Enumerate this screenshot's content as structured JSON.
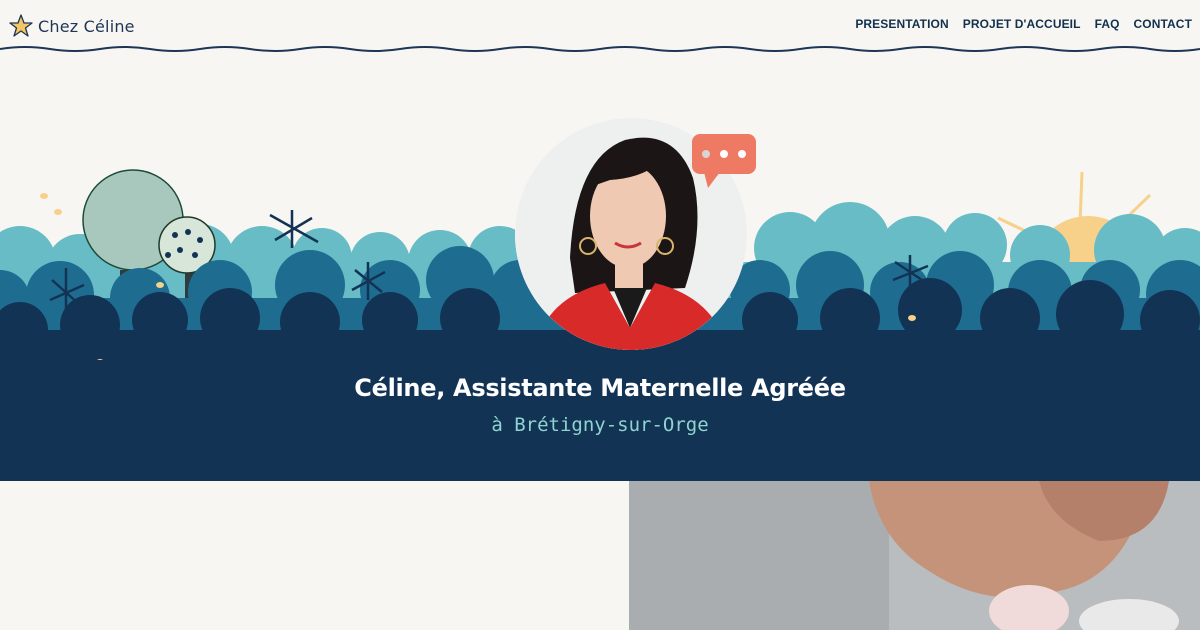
{
  "header": {
    "logo_text": "Chez Céline",
    "logo_icon": "star-icon",
    "nav": [
      {
        "label": "PRESENTATION"
      },
      {
        "label": "PROJET D'ACCUEIL"
      },
      {
        "label": "FAQ"
      },
      {
        "label": "CONTACT"
      }
    ]
  },
  "hero": {
    "title": "Céline, Assistante Maternelle Agréée",
    "subtitle": "à Brétigny-sur-Orge",
    "portrait_icon": "portrait-photo",
    "chat_icon": "chat-bubble-icon"
  },
  "colors": {
    "background": "#f7f6f2",
    "navy": "#123354",
    "teal": "#67bcc6",
    "mid_blue": "#1e6d91",
    "subtitle": "#8fd4cf",
    "sun": "#f7d08a",
    "chat": "#ef7a63"
  }
}
